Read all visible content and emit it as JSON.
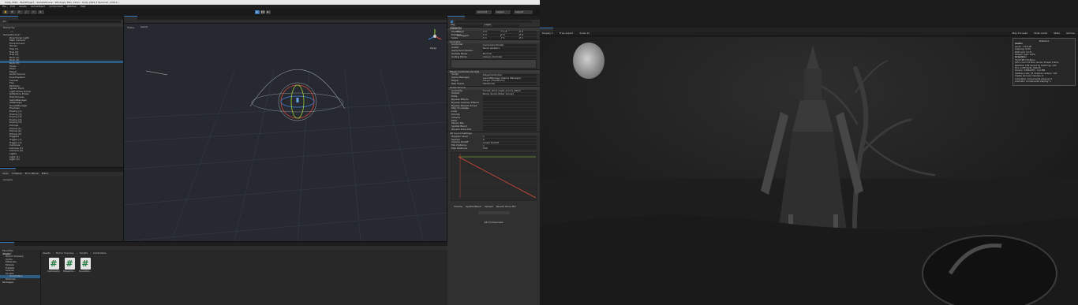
{
  "app": {
    "title": "Unity 2022 - BuildProject - SampleScene - Windows, Mac, Linux - Unity 2022.3 Personal <DX11>",
    "menu": [
      "File",
      "Edit",
      "Assets",
      "GameObject",
      "Component",
      "Window",
      "Help"
    ],
    "account_label": "Account",
    "layers_label": "Layers",
    "layout_label": "Layout"
  },
  "hierarchy": {
    "tab": "Hierarchy",
    "search_placeholder": "All",
    "scene_name": "SampleScene*",
    "items": [
      "Directional Light",
      "Main Camera",
      "Environment",
      "Terrain",
      "Tree (1)",
      "Tree (2)",
      "Tree (3)",
      "Rock (1)",
      "Rock (2)",
      "Rock (3)",
      "Tower",
      "Moon",
      "Player",
      "Audio Source",
      "EventSystem",
      "Canvas",
      "Fog",
      "Particles",
      "Spawn Point",
      "Light Probe Group",
      "Reflection Probe",
      "Post Process",
      "GameManager",
      "UIManager",
      "SoundManager",
      "Enemies",
      "Enemy (1)",
      "Enemy (2)",
      "Enemy (3)",
      "Enemy (4)",
      "Enemy (5)",
      "Pickups",
      "Pickup (1)",
      "Pickup (2)",
      "Pickup (3)",
      "Triggers",
      "Trigger (1)",
      "Trigger (2)",
      "Cameras",
      "Camera (1)",
      "Camera (2)",
      "Lights",
      "Light (1)",
      "Light (2)"
    ]
  },
  "console": {
    "tab": "Console",
    "buttons": [
      "Clear",
      "Collapse",
      "Error Pause",
      "Editor"
    ]
  },
  "scene": {
    "tabs": [
      "Scene",
      "Game"
    ],
    "persp_label": "Persp"
  },
  "inspector": {
    "tab": "Inspector",
    "object_name": "Player",
    "tag_label": "Tag",
    "tag_value": "Untagged",
    "layer_label": "Layer",
    "layer_value": "Default",
    "transform": {
      "header": "Transform",
      "rows": [
        {
          "label": "Position",
          "x": "X 0",
          "y": "Y 1.5",
          "z": "Z 0"
        },
        {
          "label": "Rotation",
          "x": "X 0",
          "y": "Y 0",
          "z": "Z 0"
        },
        {
          "label": "Scale",
          "x": "X 1",
          "y": "Y 1",
          "z": "Z 1"
        }
      ]
    },
    "animator": {
      "header": "Animator",
      "rows": [
        "Controller",
        "Avatar",
        "Apply Root Motion",
        "Update Mode",
        "Culling Mode"
      ],
      "values": [
        "CameraController",
        "None (Avatar)",
        "",
        "Normal",
        "Always Animate"
      ]
    },
    "player_controller": {
      "header": "Player Controller (Script)",
      "rows": [
        "Script",
        "Game Manager",
        "Player",
        "Max Points"
      ],
      "values": [
        "PlayerController",
        "GameManager (Game Manager)",
        "Player (Transform)",
        "MaxPoints"
      ]
    },
    "audio_source": {
      "header": "Audio Source",
      "rows": [
        "AudioClip",
        "Output",
        "Mute",
        "Bypass Effects",
        "Bypass Listener Effects",
        "Bypass Reverb Zones",
        "Play On Awake",
        "Loop",
        "Priority",
        "Volume",
        "Pitch",
        "Stereo Pan",
        "Spatial Blend",
        "Reverb Zone Mix"
      ],
      "values": [
        "Forest_wind_night_sound_effect",
        "None (Audio Mixer Group)"
      ]
    },
    "sound_settings": {
      "header": "3D Sound Settings",
      "rows": [
        "Doppler Level",
        "Spread",
        "Volume Rolloff",
        "Min Distance",
        "Max Distance"
      ],
      "values": [
        "1",
        "0",
        "Linear Rolloff",
        "1",
        "500"
      ]
    },
    "curve_legend": [
      "Volume",
      "Spatial Blend",
      "Spread",
      "Reverb Zone Mix"
    ],
    "add_component": "Add Component"
  },
  "project": {
    "tab": "Project",
    "breadcrumb": [
      "Assets",
      "Horror Scenery",
      "Scripts",
      "Controllers"
    ],
    "tree": [
      "Favorites",
      "Assets",
      "Horror Scenery",
      "Audio",
      "Materials",
      "Models",
      "Prefabs",
      "Scenes",
      "Scripts",
      "Controllers",
      "Textures",
      "Packages"
    ],
    "assets": [
      "CameraCo...",
      "PlayerCo...",
      "SoundCo..."
    ]
  },
  "game": {
    "tab": "Game",
    "display": "Display 1",
    "aspect": "Free Aspect",
    "scale": "Scale 1x",
    "play_options": [
      "Play Focused",
      "Mute Audio",
      "Stats",
      "Gizmos"
    ],
    "stats": {
      "title": "Statistics",
      "audio_header": "Audio:",
      "audio_lines": [
        "Level: -74.8 dB",
        "Clipping: 0.0%",
        "DSP load: 0.1%",
        "Stream load: 0.0%"
      ],
      "graphics_header": "Graphics:",
      "graphics_lines": [
        "72.6 FPS (13.8ms)",
        "CPU: main 13.8ms  render thread 0.9ms",
        "Batches: 185  Saved by batching: 104",
        "Tris: 1.2M  Verts: 846.3k",
        "Screen: 1366x387 - 6.0 MB",
        "SetPass calls: 53  Shadow casters: 143",
        "Visible skinned meshes: 0",
        "Animation components playing: 0",
        "Animator components playing: 1"
      ]
    }
  },
  "colors": {
    "selection": "#2c5d87",
    "accent_blue": "#3a79bb",
    "script_icon_green": "#1f7a3a"
  }
}
